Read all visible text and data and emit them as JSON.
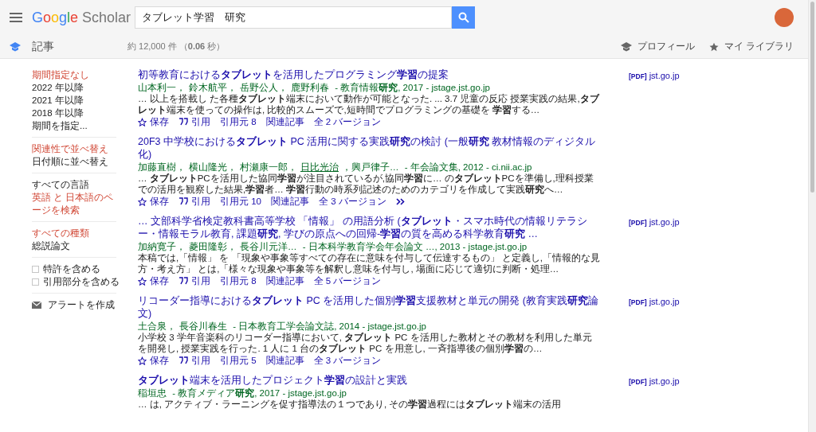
{
  "header": {
    "logo": {
      "brand": "Google",
      "product": "Scholar"
    },
    "search": {
      "value": "タブレット学習　研究"
    }
  },
  "subbar": {
    "section": "記事",
    "result_count": "約 12,000 件 （**0.06** 秒）",
    "links": [
      {
        "kind": "profile",
        "label": "プロフィール"
      },
      {
        "kind": "library",
        "label": "マイ ライブラリ"
      }
    ]
  },
  "sidebar": {
    "groups": [
      {
        "items": [
          {
            "label": "期間指定なし",
            "selected": true
          },
          {
            "label": "2022 年以降",
            "selected": false
          },
          {
            "label": "2021 年以降",
            "selected": false
          },
          {
            "label": "2018 年以降",
            "selected": false
          },
          {
            "label": "期間を指定...",
            "selected": false
          }
        ]
      },
      {
        "items": [
          {
            "label": "関連性で並べ替え",
            "selected": true
          },
          {
            "label": "日付順に並べ替え",
            "selected": false
          }
        ]
      },
      {
        "items": [
          {
            "label": "すべての言語",
            "selected": false
          },
          {
            "label": "英語 と 日本語のページを検索",
            "selected": true
          }
        ]
      },
      {
        "items": [
          {
            "label": "すべての種類",
            "selected": true
          },
          {
            "label": "総説論文",
            "selected": false
          }
        ]
      },
      {
        "checkboxes": [
          {
            "label": "特許を含める",
            "checked": false
          },
          {
            "label": "引用部分を含める",
            "checked": false
          }
        ]
      }
    ],
    "alert": "アラートを作成"
  },
  "results": [
    {
      "title": "初等教育における**タブレット**を活用したプログラミング**学習**の提案",
      "authors": [
        {
          "name": "山本利一，",
          "underlined": false
        },
        {
          "name": "鈴木航平，",
          "underlined": false
        },
        {
          "name": "岳野公人，",
          "underlined": false
        },
        {
          "name": "鹿野利春",
          "underlined": false
        }
      ],
      "source": " - 教育情報**研究**, 2017 - jstage.jst.go.jp",
      "snippet": "… 以上を搭載し た各種**タブレット**端末において動作が可能となった. ... 3.7 児童の反応 授業実践の結果,**タブレット**端末を使っての操作は, 比較的スムーズで,短時間でプログラミングの基礎を **学習**する…",
      "actions": [
        {
          "kind": "save",
          "label": "保存"
        },
        {
          "kind": "cite",
          "label": "引用"
        },
        {
          "kind": "text",
          "label": "引用元 8"
        },
        {
          "kind": "text",
          "label": "関連記事"
        },
        {
          "kind": "text",
          "label": "全 2 バージョン"
        }
      ],
      "pdf": {
        "tag": "[PDF]",
        "domain": "jst.go.jp"
      }
    },
    {
      "title": "20F3 中学校における**タブレット** PC 活用に関する実践**研究**の検討 (一般**研究** 教材情報のディジタル化)",
      "authors": [
        {
          "name": "加藤直樹，",
          "underlined": false
        },
        {
          "name": "横山隆光，",
          "underlined": false
        },
        {
          "name": "村瀬康一郎，",
          "underlined": false
        },
        {
          "name": "日比光治",
          "underlined": true
        },
        {
          "name": "，興戸律子…",
          "underlined": false
        }
      ],
      "source": " - 年会論文集, 2012 - ci.nii.ac.jp",
      "snippet": "… **タブレット**PCを活用した協同**学習**が注目されているが,協同**学習**に… の**タブレット**PCを準備し,理科授業での活用を観察した結果,**学習**者… **学習**行動の時系列記述のためのカテゴリを作成して実践**研究**へ…",
      "actions": [
        {
          "kind": "save",
          "label": "保存"
        },
        {
          "kind": "cite",
          "label": "引用"
        },
        {
          "kind": "text",
          "label": "引用元 10"
        },
        {
          "kind": "text",
          "label": "関連記事"
        },
        {
          "kind": "text",
          "label": "全 3 バージョン"
        },
        {
          "kind": "more"
        }
      ]
    },
    {
      "title": "… 文部科学省検定教科書高等学校 「情報」 の用語分析 (**タブレット**・スマホ時代の情報リテラシー・情報モラル教育, 課題**研究**, 学びの原点への回帰-**学習**の質を高める科学教育**研究** …",
      "authors": [
        {
          "name": "加納寛子，",
          "underlined": false
        },
        {
          "name": "菱田隆彰，",
          "underlined": false
        },
        {
          "name": "長谷川元洋…",
          "underlined": false
        }
      ],
      "source": " - 日本科学教育学会年会論文 …, 2013 - jstage.jst.go.jp",
      "snippet": "本稿では,「情報」 を 「現象や事象等すべての存在に意味を付与して伝達するもの」 と定義し,「情報的な見方・考え方」 とは,「様々な現象や事象等を解釈し意味を付与し, 場面に応じて適切に判断・処理…",
      "actions": [
        {
          "kind": "save",
          "label": "保存"
        },
        {
          "kind": "cite",
          "label": "引用"
        },
        {
          "kind": "text",
          "label": "引用元 8"
        },
        {
          "kind": "text",
          "label": "関連記事"
        },
        {
          "kind": "text",
          "label": "全 5 バージョン"
        }
      ],
      "pdf": {
        "tag": "[PDF]",
        "domain": "jst.go.jp"
      }
    },
    {
      "title": "リコーダー指導における**タブレット** PC を活用した個別**学習**支援教材と単元の開発 (教育実践**研究**論文)",
      "authors": [
        {
          "name": "土合泉，",
          "underlined": false
        },
        {
          "name": "長谷川春生",
          "underlined": false
        }
      ],
      "source": " - 日本教育工学会論文誌, 2014 - jstage.jst.go.jp",
      "snippet": "小学校 3 学年音楽科のリコーダー指導において, **タブレット** PC を活用した教材とその教材を利用した単元を開発し, 授業実践を行った. 1 人に 1 台の**タブレット** PC を用意し, 一斉指導後の個別**学習**の…",
      "actions": [
        {
          "kind": "save",
          "label": "保存"
        },
        {
          "kind": "cite",
          "label": "引用"
        },
        {
          "kind": "text",
          "label": "引用元 5"
        },
        {
          "kind": "text",
          "label": "関連記事"
        },
        {
          "kind": "text",
          "label": "全 3 バージョン"
        }
      ],
      "pdf": {
        "tag": "[PDF]",
        "domain": "jst.go.jp"
      }
    },
    {
      "title": "**タブレット**端末を活用したプロジェクト**学習**の設計と実践",
      "authors": [
        {
          "name": "稲垣忠",
          "underlined": false
        }
      ],
      "source": " - 教育メディア**研究**, 2017 - jstage.jst.go.jp",
      "snippet": "… は, アクティブ・ラーニングを促す指導法の１つであり, その**学習**過程には**タブレット**端末の活用",
      "pdf": {
        "tag": "[PDF]",
        "domain": "jst.go.jp"
      }
    }
  ]
}
